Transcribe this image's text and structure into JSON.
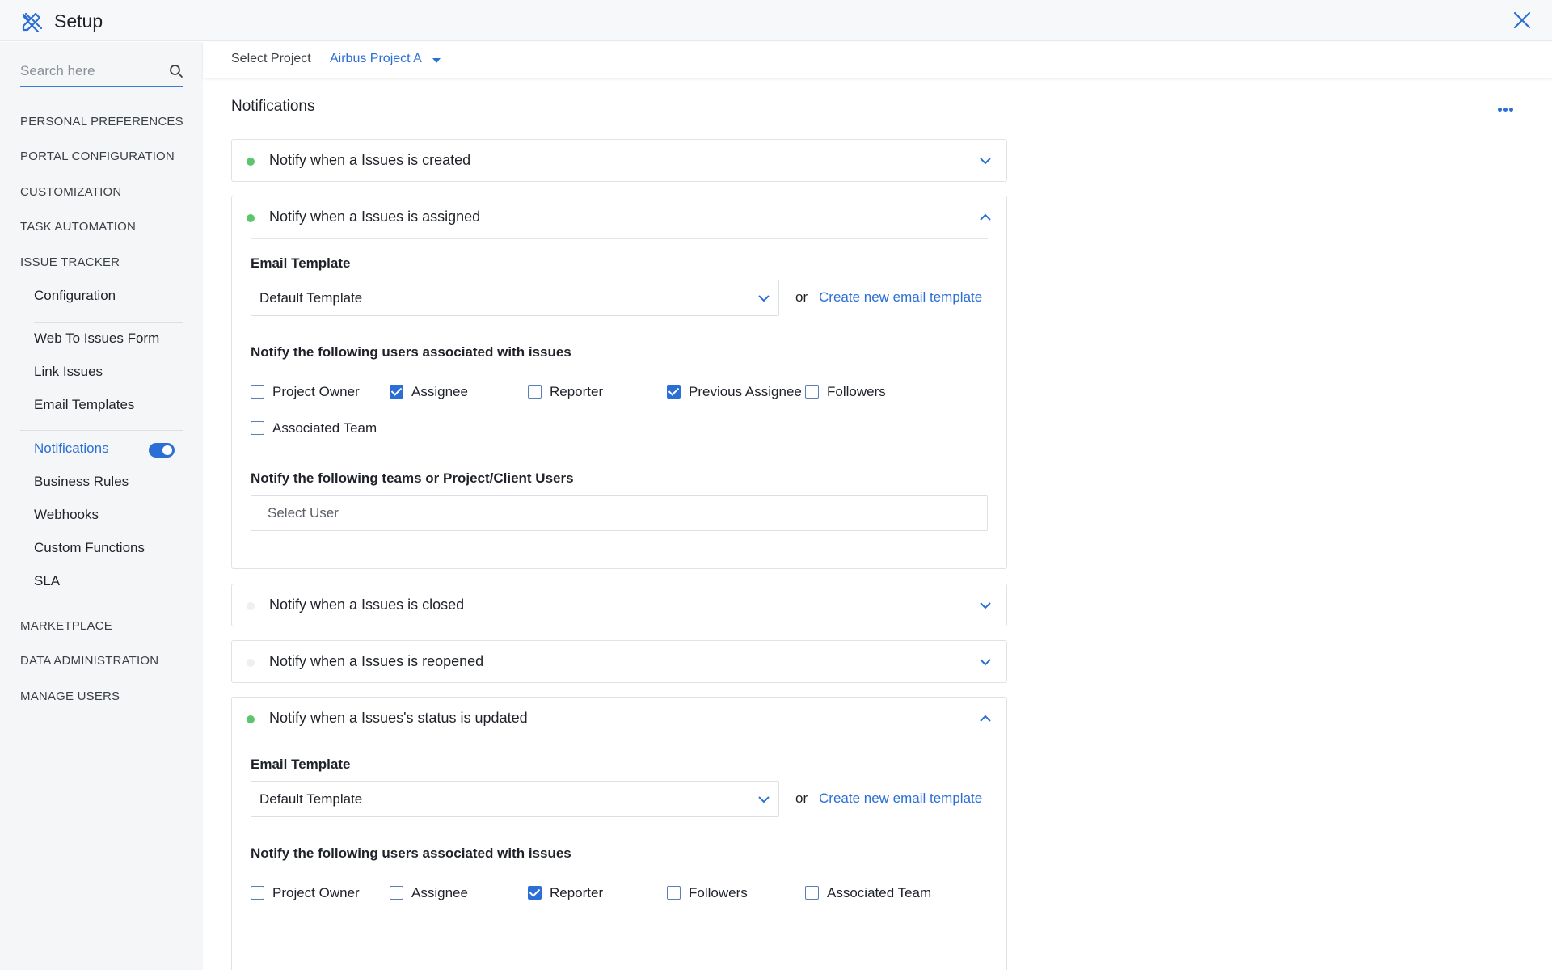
{
  "header": {
    "title": "Setup"
  },
  "colors": {
    "accent": "#2b6fd6",
    "enabled_dot": "#5cc66f",
    "disabled_dot": "#eeeff1"
  },
  "sidebar": {
    "search_placeholder": "Search here",
    "sections": {
      "personal": "PERSONAL PREFERENCES",
      "portal": "PORTAL CONFIGURATION",
      "customization": "CUSTOMIZATION",
      "task_automation": "TASK AUTOMATION",
      "issue_tracker": "ISSUE TRACKER",
      "marketplace": "MARKETPLACE",
      "data_admin": "DATA ADMINISTRATION",
      "manage_users": "MANAGE USERS"
    },
    "items": {
      "configuration": "Configuration",
      "web_to_issues": "Web To Issues Form",
      "link_issues": "Link Issues",
      "email_templates": "Email Templates",
      "notifications": "Notifications",
      "business_rules": "Business Rules",
      "webhooks": "Webhooks",
      "custom_functions": "Custom Functions",
      "sla": "SLA"
    },
    "notifications_toggle": "on"
  },
  "project_bar": {
    "label": "Select Project",
    "project": "Airbus Project A"
  },
  "page_title": "Notifications",
  "cards": {
    "created": {
      "title": "Notify when a Issues is created",
      "enabled": true,
      "expanded": false
    },
    "assigned": {
      "title": "Notify when a Issues is assigned",
      "enabled": true,
      "expanded": true,
      "email_template_label": "Email Template",
      "template_value": "Default Template",
      "or": "or",
      "create_link": "Create new email template",
      "users_label": "Notify the following users associated with issues",
      "checkboxes": {
        "project_owner": {
          "label": "Project Owner",
          "checked": false
        },
        "assignee": {
          "label": "Assignee",
          "checked": true
        },
        "reporter": {
          "label": "Reporter",
          "checked": false
        },
        "previous_assignee": {
          "label": "Previous Assignee",
          "checked": true
        },
        "followers": {
          "label": "Followers",
          "checked": false
        },
        "associated_team": {
          "label": "Associated Team",
          "checked": false
        }
      },
      "teams_label": "Notify the following teams or Project/Client Users",
      "select_user": "Select User"
    },
    "closed": {
      "title": "Notify when a Issues is closed",
      "enabled": false,
      "expanded": false
    },
    "reopened": {
      "title": "Notify when a Issues is reopened",
      "enabled": false,
      "expanded": false
    },
    "status": {
      "title": "Notify when a Issues's status is updated",
      "enabled": true,
      "expanded": true,
      "email_template_label": "Email Template",
      "template_value": "Default Template",
      "or": "or",
      "create_link": "Create new email template",
      "users_label": "Notify the following users associated with issues",
      "checkboxes": {
        "project_owner": {
          "label": "Project Owner",
          "checked": false
        },
        "assignee": {
          "label": "Assignee",
          "checked": false
        },
        "reporter": {
          "label": "Reporter",
          "checked": true
        },
        "followers": {
          "label": "Followers",
          "checked": false
        },
        "associated_team": {
          "label": "Associated Team",
          "checked": false
        }
      }
    }
  }
}
